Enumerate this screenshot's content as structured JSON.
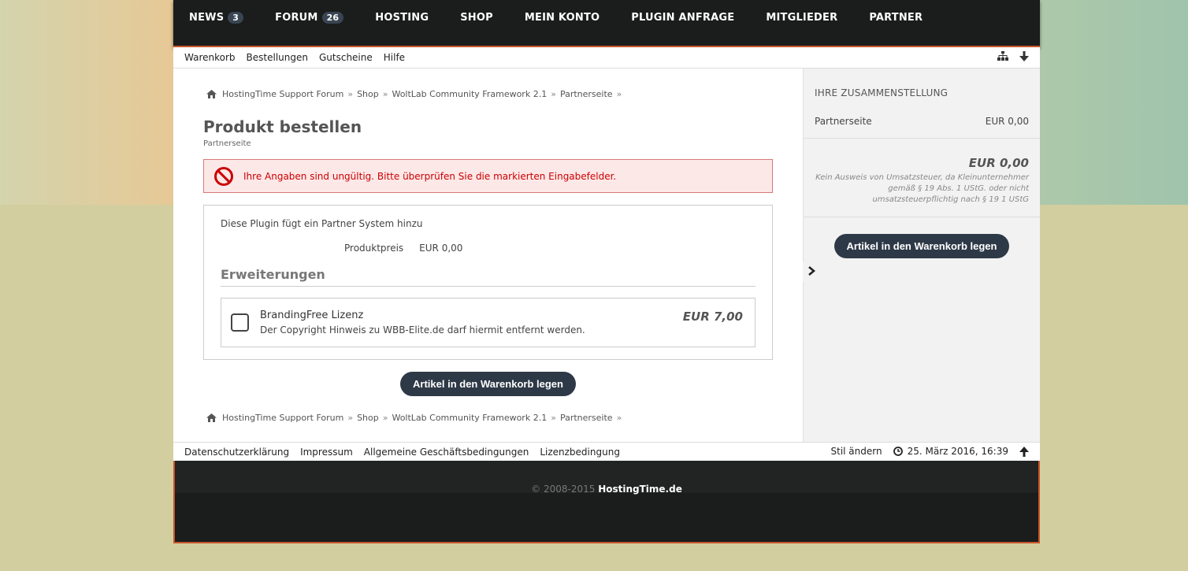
{
  "main_nav": [
    {
      "label": "NEWS",
      "badge": "3"
    },
    {
      "label": "FORUM",
      "badge": "26"
    },
    {
      "label": "HOSTING"
    },
    {
      "label": "SHOP"
    },
    {
      "label": "MEIN KONTO"
    },
    {
      "label": "PLUGIN ANFRAGE"
    },
    {
      "label": "MITGLIEDER"
    },
    {
      "label": "PARTNER"
    }
  ],
  "sub_nav": [
    "Warenkorb",
    "Bestellungen",
    "Gutscheine",
    "Hilfe"
  ],
  "breadcrumb": [
    "HostingTime Support Forum",
    "Shop",
    "WoltLab Community Framework 2.1",
    "Partnerseite"
  ],
  "breadcrumb_sep": "»",
  "page": {
    "title": "Produkt bestellen",
    "subtitle": "Partnerseite",
    "error": "Ihre Angaben sind ungültig. Bitte überprüfen Sie die markierten Eingabefelder."
  },
  "product": {
    "description": "Diese Plugin fügt ein Partner System hinzu",
    "price_label": "Produktpreis",
    "price_value": "EUR 0,00",
    "extensions_heading": "Erweiterungen",
    "extension": {
      "name": "BrandingFree Lizenz",
      "info": "Der Copyright Hinweis zu WBB-Elite.de darf hiermit entfernt werden.",
      "price": "EUR 7,00",
      "checked": false
    },
    "cart_button": "Artikel in den Warenkorb legen"
  },
  "sidebar": {
    "heading": "IHRE ZUSAMMENSTELLUNG",
    "line_label": "Partnerseite",
    "line_value": "EUR 0,00",
    "total": "EUR 0,00",
    "note": "Kein Ausweis von Umsatzsteuer, da Kleinunternehmer gemäß § 19 Abs. 1 UStG. oder nicht umsatzsteuerpflichtig nach § 19 1 UStG",
    "cart_button": "Artikel in den Warenkorb legen"
  },
  "footer_nav": [
    "Datenschutzerklärung",
    "Impressum",
    "Allgemeine Geschäftsbedingungen",
    "Lizenzbedingung"
  ],
  "footer_right": {
    "style_label": "Stil ändern",
    "datetime": "25. März 2016, 16:39"
  },
  "footer": {
    "copyright": "© 2008-2015",
    "site": "HostingTime.de"
  },
  "colors": {
    "accent": "#c8562b",
    "button": "#2e3947",
    "error_text": "#cc0000"
  }
}
